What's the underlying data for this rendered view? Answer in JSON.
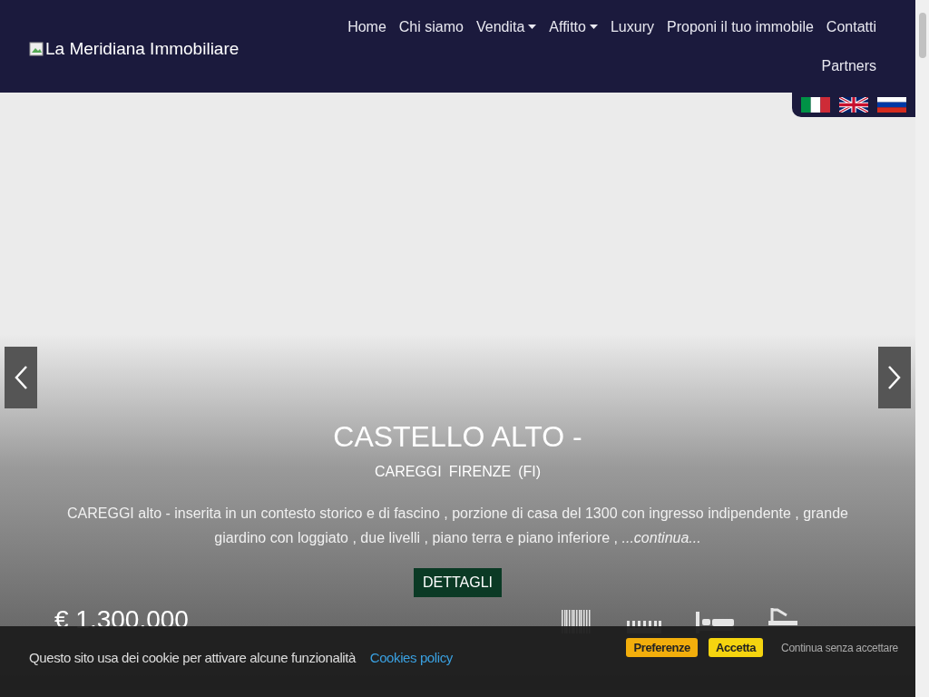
{
  "header": {
    "logo_alt": "La Meridiana Immobiliare"
  },
  "nav": [
    {
      "label": "Home",
      "dropdown": false
    },
    {
      "label": "Chi siamo",
      "dropdown": false
    },
    {
      "label": "Vendita",
      "dropdown": true
    },
    {
      "label": "Affitto",
      "dropdown": true
    },
    {
      "label": "Luxury",
      "dropdown": false
    },
    {
      "label": "Proponi il tuo immobile",
      "dropdown": false
    },
    {
      "label": "Contatti",
      "dropdown": false
    },
    {
      "label": "Partners",
      "dropdown": false
    }
  ],
  "languages": [
    {
      "kind": "italy"
    },
    {
      "kind": "uk"
    },
    {
      "kind": "russia"
    }
  ],
  "slide": {
    "title": "CASTELLO ALTO -",
    "location": [
      "CAREGGI",
      "FIRENZE",
      "(FI)"
    ],
    "description": "CAREGGI alto - inserita in un contesto storico e di fascino , porzione di casa del 1300 con ingresso indipendente , grande giardino con loggiato , due livelli , piano terra e piano inferiore , *...continua...*",
    "button": "DETTAGLI",
    "price": "€ 1.300.000",
    "features": [
      {
        "kind": "bars"
      },
      {
        "kind": "comb"
      },
      {
        "kind": "bed"
      },
      {
        "kind": "bath"
      }
    ]
  },
  "cookie": {
    "text": "Questo sito usa dei cookie per attivare alcune funzionalità",
    "link": "Cookies policy",
    "buttons": [
      {
        "label": "Preferenze",
        "kind": "orange"
      },
      {
        "label": "Accetta",
        "kind": "yellow"
      }
    ],
    "reject": "Continua senza accettare"
  }
}
